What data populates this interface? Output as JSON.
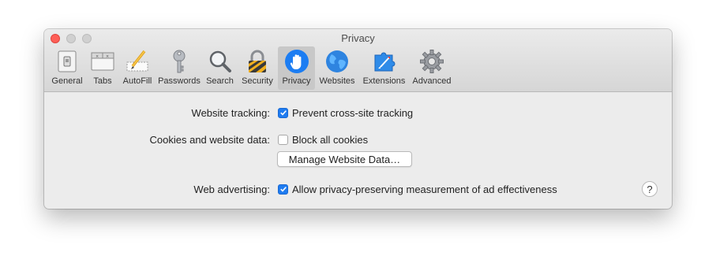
{
  "window": {
    "title": "Privacy"
  },
  "toolbar": {
    "items": [
      {
        "label": "General",
        "icon": "general-icon"
      },
      {
        "label": "Tabs",
        "icon": "tabs-icon"
      },
      {
        "label": "AutoFill",
        "icon": "autofill-icon"
      },
      {
        "label": "Passwords",
        "icon": "key-icon"
      },
      {
        "label": "Search",
        "icon": "magnifier-icon"
      },
      {
        "label": "Security",
        "icon": "padlock-icon"
      },
      {
        "label": "Privacy",
        "icon": "hand-icon",
        "selected": true
      },
      {
        "label": "Websites",
        "icon": "globe-icon"
      },
      {
        "label": "Extensions",
        "icon": "puzzle-icon"
      },
      {
        "label": "Advanced",
        "icon": "gear-icon"
      }
    ]
  },
  "settings": {
    "website_tracking": {
      "label": "Website tracking:",
      "option": "Prevent cross-site tracking",
      "checked": true
    },
    "cookies": {
      "label": "Cookies and website data:",
      "option": "Block all cookies",
      "checked": false,
      "button": "Manage Website Data…"
    },
    "advertising": {
      "label": "Web advertising:",
      "option": "Allow privacy-preserving measurement of ad effectiveness",
      "checked": true
    }
  },
  "help_button": {
    "label": "?"
  },
  "colors": {
    "accent": "#1f7cf0",
    "close": "#fe5f57"
  }
}
